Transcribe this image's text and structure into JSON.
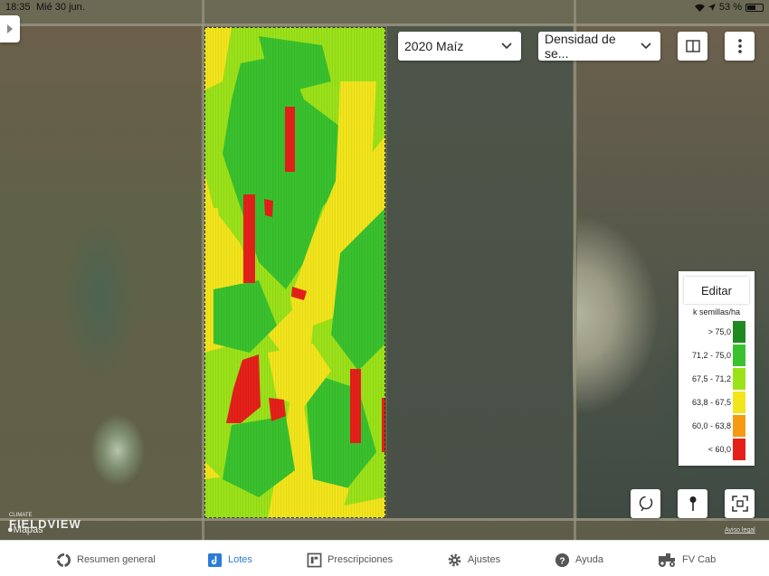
{
  "status_bar": {
    "time": "18:35",
    "date": "Mié 30 jun.",
    "battery": "53 %"
  },
  "season_dropdown": {
    "selected": "2020 Maíz"
  },
  "layer_dropdown": {
    "selected": "Densidad de se..."
  },
  "legend": {
    "edit_label": "Editar",
    "unit": "k semillas/ha",
    "ranges": [
      {
        "label": "> 75,0",
        "color": "#1f8a1f"
      },
      {
        "label": "71,2 - 75,0",
        "color": "#3ac12e"
      },
      {
        "label": "67,5 - 71,2",
        "color": "#9be21a"
      },
      {
        "label": "63,8 - 67,5",
        "color": "#f2e51c"
      },
      {
        "label": "60,0 - 63,8",
        "color": "#f59a12"
      },
      {
        "label": "< 60,0",
        "color": "#e5201a"
      }
    ]
  },
  "map_logos": {
    "brand_top": "CLIMATE",
    "brand": "FIELDVIEW",
    "maps": "Mapas",
    "legal": "Aviso legal"
  },
  "tabs": [
    {
      "label": "Resumen general",
      "icon": "overview-ring-icon",
      "active": false
    },
    {
      "label": "Lotes",
      "icon": "fields-icon",
      "active": true
    },
    {
      "label": "Prescripciones",
      "icon": "prescriptions-icon",
      "active": false
    },
    {
      "label": "Ajustes",
      "icon": "gear-icon",
      "active": false
    },
    {
      "label": "Ayuda",
      "icon": "help-icon",
      "active": false
    },
    {
      "label": "FV Cab",
      "icon": "tractor-icon",
      "active": false
    }
  ]
}
